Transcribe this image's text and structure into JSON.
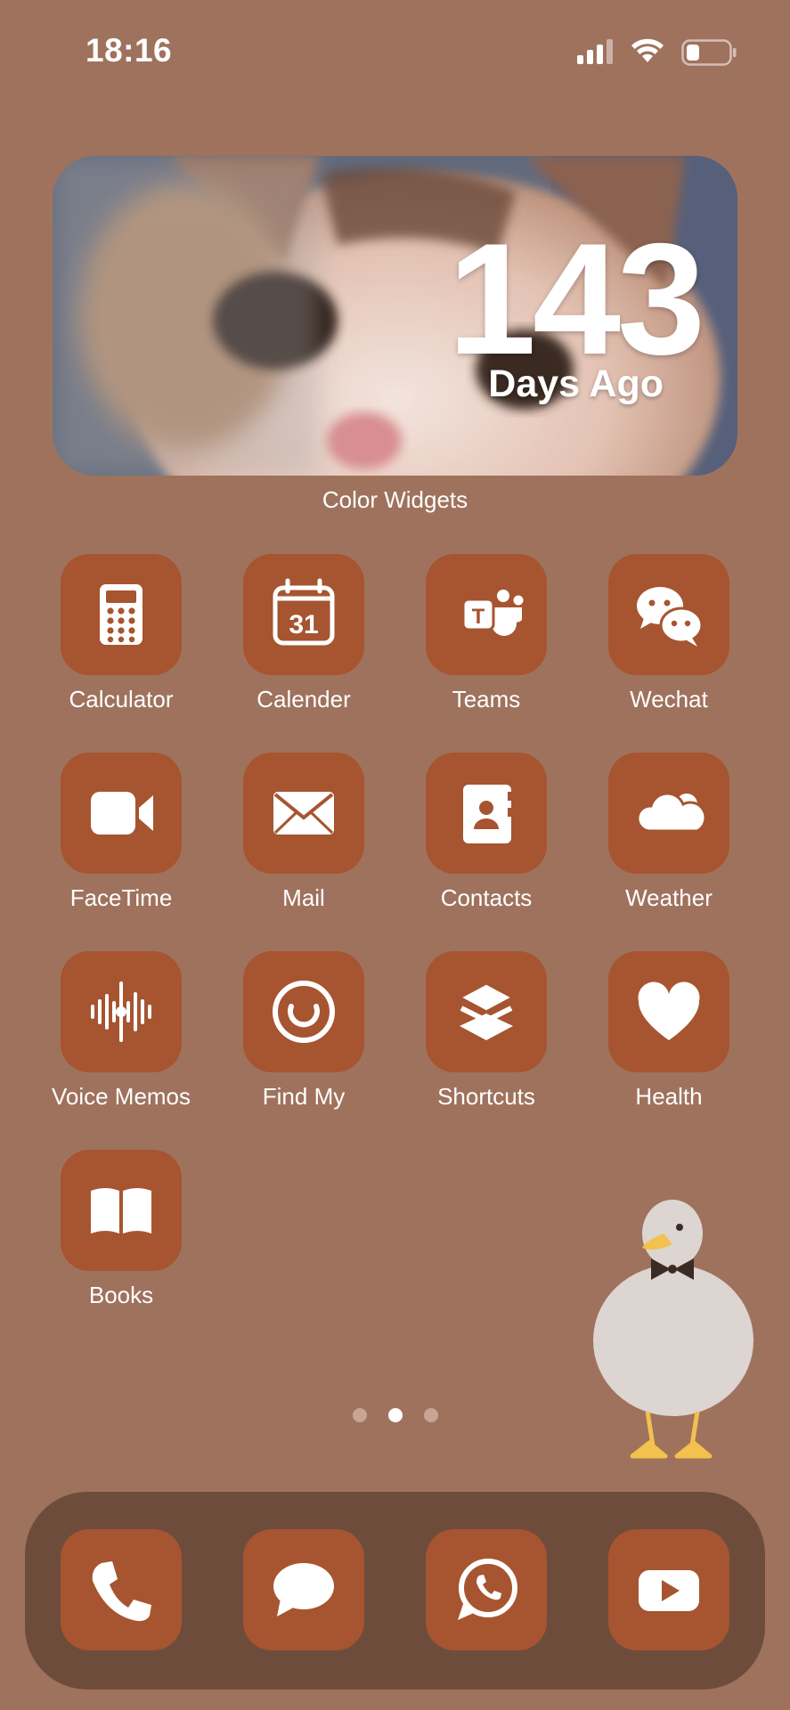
{
  "status_bar": {
    "time": "18:16",
    "icons": [
      "cellular-signal-icon",
      "wifi-icon",
      "battery-icon"
    ]
  },
  "widget": {
    "count": "143",
    "caption": "Days Ago",
    "app_label": "Color Widgets"
  },
  "apps": [
    {
      "label": "Calculator",
      "icon": "calculator-icon"
    },
    {
      "label": "Calender",
      "icon": "calendar-icon",
      "icon_text": "31"
    },
    {
      "label": "Teams",
      "icon": "teams-icon",
      "icon_text": "T"
    },
    {
      "label": "Wechat",
      "icon": "wechat-icon"
    },
    {
      "label": "FaceTime",
      "icon": "video-camera-icon"
    },
    {
      "label": "Mail",
      "icon": "envelope-icon"
    },
    {
      "label": "Contacts",
      "icon": "contact-book-icon"
    },
    {
      "label": "Weather",
      "icon": "cloud-icon"
    },
    {
      "label": "Voice Memos",
      "icon": "waveform-icon"
    },
    {
      "label": "Find My",
      "icon": "radar-icon"
    },
    {
      "label": "Shortcuts",
      "icon": "layers-icon"
    },
    {
      "label": "Health",
      "icon": "heart-icon"
    },
    {
      "label": "Books",
      "icon": "book-icon"
    }
  ],
  "page_indicator": {
    "pages": 3,
    "current": 2
  },
  "dock": [
    {
      "icon": "phone-icon"
    },
    {
      "icon": "message-bubble-icon"
    },
    {
      "icon": "whatsapp-icon"
    },
    {
      "icon": "youtube-play-icon"
    }
  ],
  "colors": {
    "background": "#9f725d",
    "tile": "#a65530",
    "dock": "#6e4c3c"
  }
}
